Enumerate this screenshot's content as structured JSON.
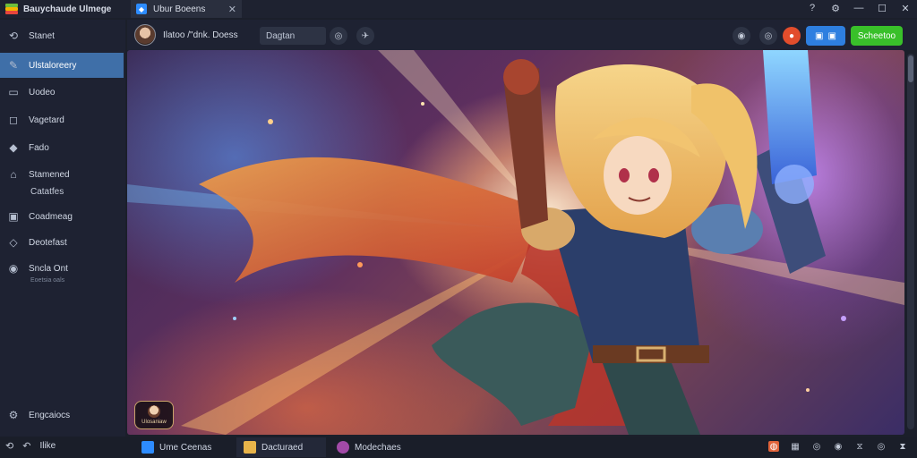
{
  "app": {
    "title": "Bauychaude Ulmege"
  },
  "window_tab": {
    "label": "Ubur Boeens",
    "close_glyph": "✕"
  },
  "window_controls": {
    "minimize": "—",
    "maximize": "☐",
    "close": "✕"
  },
  "sidebar": {
    "items": [
      {
        "label": "Stanet",
        "icon": "back-arrow-icon",
        "glyph": "⟲"
      },
      {
        "label": "Ulstaloreery",
        "icon": "paint-brush-icon",
        "glyph": "✎",
        "active": true
      },
      {
        "label": "Uodeo",
        "icon": "monitor-icon",
        "glyph": "▭"
      },
      {
        "label": "Vagetard",
        "icon": "chat-icon",
        "glyph": "◻"
      },
      {
        "label": "Fado",
        "icon": "wifi-icon",
        "glyph": "◆"
      },
      {
        "label": "Stamened",
        "sub_label": "Catatfes",
        "icon": "folder-icon",
        "glyph": "⌂"
      },
      {
        "label": "Coadmeag",
        "icon": "window-icon",
        "glyph": "▣"
      },
      {
        "label": "Deotefast",
        "icon": "tag-icon",
        "glyph": "◇"
      },
      {
        "label": "Sncla Ont",
        "sub_label": "Eoetsia oals",
        "icon": "globe-icon",
        "glyph": "◉"
      }
    ],
    "bottom_item": {
      "label": "Engcaiocs",
      "icon": "settings-icon",
      "glyph": "⚙"
    }
  },
  "toolbar": {
    "profile_label": "Ilatoo /\"dnk. Doess",
    "search_pill": "Dagtan",
    "round_button_1_glyph": "◎",
    "round_button_2_glyph": "✈",
    "right_icons": [
      "◉",
      "◎",
      "●"
    ],
    "blue_button_glyphs": [
      "▣",
      "▣"
    ],
    "green_button_label": "Scheetoo"
  },
  "statusbar": {
    "left_label": "Ilike",
    "tabs": [
      {
        "label": "Ume Ceenas",
        "icon_color": "#2d8cff"
      },
      {
        "label": "Dacturaed",
        "icon_color": "#e8b44a",
        "active": true
      },
      {
        "label": "Modechaes",
        "icon_color": "#a24aa8"
      }
    ],
    "right_icons": [
      "◍",
      "▦",
      "◎",
      "◉",
      "⧖",
      "◎",
      "⧗"
    ]
  },
  "watermark": {
    "text": "Ulosaniaw"
  }
}
